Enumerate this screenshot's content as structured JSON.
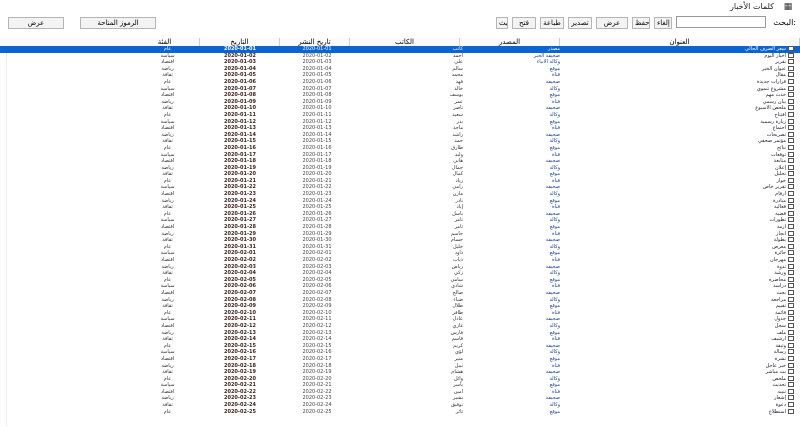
{
  "window": {
    "title": "كلمات الأخبار"
  },
  "toolbar": {
    "search_label": "البحث:",
    "buttons": [
      "إلغاء",
      "حفظ",
      "عرض",
      "تصدير",
      "طباعة",
      "فتح",
      "تحديث"
    ],
    "left_buttons": [
      "الرموز المتاحة",
      "عرض"
    ]
  },
  "columns": [
    "العنوان",
    "المصدر",
    "الكاتب",
    "تاريخ النشر",
    "التاريخ",
    "الفئة"
  ],
  "rows": [
    {
      "title": "سعر الصرف الحالي",
      "source": "مصدر",
      "author": "كاتب",
      "pub": "2020-01-01",
      "date": "2020-01-01",
      "cat": "عام"
    },
    {
      "title": "أخبار اليوم",
      "source": "صحيفة الخبر",
      "author": "احمد",
      "pub": "2020-01-02",
      "date": "2020-01-02",
      "cat": "سياسة"
    },
    {
      "title": "تقرير",
      "source": "وكالة الأنباء",
      "author": "علي",
      "pub": "2020-01-03",
      "date": "2020-01-03",
      "cat": "اقتصاد"
    },
    {
      "title": "عنوان الخبر",
      "source": "موقع",
      "author": "سالم",
      "pub": "2020-01-04",
      "date": "2020-01-04",
      "cat": "رياضة"
    },
    {
      "title": "مقال",
      "source": "قناة",
      "author": "محمد",
      "pub": "2020-01-05",
      "date": "2020-01-05",
      "cat": "ثقافة"
    },
    {
      "title": "قرارات جديدة",
      "source": "صحيفة",
      "author": "فهد",
      "pub": "2020-01-06",
      "date": "2020-01-06",
      "cat": "عام"
    },
    {
      "title": "مشروع تنموي",
      "source": "وكالة",
      "author": "خالد",
      "pub": "2020-01-07",
      "date": "2020-01-07",
      "cat": "سياسة"
    },
    {
      "title": "حدث مهم",
      "source": "موقع",
      "author": "يوسف",
      "pub": "2020-01-08",
      "date": "2020-01-08",
      "cat": "اقتصاد"
    },
    {
      "title": "بيان رسمي",
      "source": "قناة",
      "author": "عمر",
      "pub": "2020-01-09",
      "date": "2020-01-09",
      "cat": "رياضة"
    },
    {
      "title": "ملخص الأسبوع",
      "source": "صحيفة",
      "author": "ناصر",
      "pub": "2020-01-10",
      "date": "2020-01-10",
      "cat": "ثقافة"
    },
    {
      "title": "افتتاح",
      "source": "وكالة",
      "author": "سعيد",
      "pub": "2020-01-11",
      "date": "2020-01-11",
      "cat": "عام"
    },
    {
      "title": "زيارة رسمية",
      "source": "موقع",
      "author": "بدر",
      "pub": "2020-01-12",
      "date": "2020-01-12",
      "cat": "سياسة"
    },
    {
      "title": "اجتماع",
      "source": "قناة",
      "author": "ماجد",
      "pub": "2020-01-13",
      "date": "2020-01-13",
      "cat": "اقتصاد"
    },
    {
      "title": "تصريحات",
      "source": "صحيفة",
      "author": "راشد",
      "pub": "2020-01-14",
      "date": "2020-01-14",
      "cat": "رياضة"
    },
    {
      "title": "مؤتمر صحفي",
      "source": "وكالة",
      "author": "حمد",
      "pub": "2020-01-15",
      "date": "2020-01-15",
      "cat": "ثقافة"
    },
    {
      "title": "نتائج",
      "source": "موقع",
      "author": "طارق",
      "pub": "2020-01-16",
      "date": "2020-01-16",
      "cat": "عام"
    },
    {
      "title": "توقعات",
      "source": "قناة",
      "author": "وليد",
      "pub": "2020-01-17",
      "date": "2020-01-17",
      "cat": "سياسة"
    },
    {
      "title": "متابعة",
      "source": "صحيفة",
      "author": "هاني",
      "pub": "2020-01-18",
      "date": "2020-01-18",
      "cat": "اقتصاد"
    },
    {
      "title": "إعلان",
      "source": "وكالة",
      "author": "جمال",
      "pub": "2020-01-19",
      "date": "2020-01-19",
      "cat": "رياضة"
    },
    {
      "title": "تحليل",
      "source": "موقع",
      "author": "كمال",
      "pub": "2020-01-20",
      "date": "2020-01-20",
      "cat": "ثقافة"
    },
    {
      "title": "حوار",
      "source": "قناة",
      "author": "زياد",
      "pub": "2020-01-21",
      "date": "2020-01-21",
      "cat": "عام"
    },
    {
      "title": "تقرير خاص",
      "source": "صحيفة",
      "author": "رامي",
      "pub": "2020-01-22",
      "date": "2020-01-22",
      "cat": "سياسة"
    },
    {
      "title": "أرقام",
      "source": "وكالة",
      "author": "مازن",
      "pub": "2020-01-23",
      "date": "2020-01-23",
      "cat": "اقتصاد"
    },
    {
      "title": "مبادرة",
      "source": "موقع",
      "author": "نادر",
      "pub": "2020-01-24",
      "date": "2020-01-24",
      "cat": "رياضة"
    },
    {
      "title": "فعالية",
      "source": "قناة",
      "author": "إياد",
      "pub": "2020-01-25",
      "date": "2020-01-25",
      "cat": "ثقافة"
    },
    {
      "title": "قضية",
      "source": "صحيفة",
      "author": "باسل",
      "pub": "2020-01-26",
      "date": "2020-01-26",
      "cat": "عام"
    },
    {
      "title": "تطورات",
      "source": "وكالة",
      "author": "تامر",
      "pub": "2020-01-27",
      "date": "2020-01-27",
      "cat": "سياسة"
    },
    {
      "title": "أزمة",
      "source": "موقع",
      "author": "ثامر",
      "pub": "2020-01-28",
      "date": "2020-01-28",
      "cat": "اقتصاد"
    },
    {
      "title": "انجاز",
      "source": "قناة",
      "author": "جاسم",
      "pub": "2020-01-29",
      "date": "2020-01-29",
      "cat": "رياضة"
    },
    {
      "title": "بطولة",
      "source": "صحيفة",
      "author": "حسام",
      "pub": "2020-01-30",
      "date": "2020-01-30",
      "cat": "ثقافة"
    },
    {
      "title": "معرض",
      "source": "وكالة",
      "author": "خليل",
      "pub": "2020-01-31",
      "date": "2020-01-31",
      "cat": "عام"
    },
    {
      "title": "جائزة",
      "source": "موقع",
      "author": "داود",
      "pub": "2020-02-01",
      "date": "2020-02-01",
      "cat": "سياسة"
    },
    {
      "title": "مهرجان",
      "source": "قناة",
      "author": "ذياب",
      "pub": "2020-02-02",
      "date": "2020-02-02",
      "cat": "اقتصاد"
    },
    {
      "title": "ندوة",
      "source": "صحيفة",
      "author": "رياض",
      "pub": "2020-02-03",
      "date": "2020-02-03",
      "cat": "رياضة"
    },
    {
      "title": "ورشة",
      "source": "وكالة",
      "author": "زكي",
      "pub": "2020-02-04",
      "date": "2020-02-04",
      "cat": "ثقافة"
    },
    {
      "title": "محاضرة",
      "source": "موقع",
      "author": "سامي",
      "pub": "2020-02-05",
      "date": "2020-02-05",
      "cat": "عام"
    },
    {
      "title": "دراسة",
      "source": "قناة",
      "author": "شادي",
      "pub": "2020-02-06",
      "date": "2020-02-06",
      "cat": "سياسة"
    },
    {
      "title": "بحث",
      "source": "صحيفة",
      "author": "صالح",
      "pub": "2020-02-07",
      "date": "2020-02-07",
      "cat": "اقتصاد"
    },
    {
      "title": "مراجعة",
      "source": "وكالة",
      "author": "ضياء",
      "pub": "2020-02-08",
      "date": "2020-02-08",
      "cat": "رياضة"
    },
    {
      "title": "تقييم",
      "source": "موقع",
      "author": "طلال",
      "pub": "2020-02-09",
      "date": "2020-02-09",
      "cat": "ثقافة"
    },
    {
      "title": "قائمة",
      "source": "قناة",
      "author": "ظافر",
      "pub": "2020-02-10",
      "date": "2020-02-10",
      "cat": "عام"
    },
    {
      "title": "جدول",
      "source": "صحيفة",
      "author": "عادل",
      "pub": "2020-02-11",
      "date": "2020-02-11",
      "cat": "سياسة"
    },
    {
      "title": "سجل",
      "source": "وكالة",
      "author": "غازي",
      "pub": "2020-02-12",
      "date": "2020-02-12",
      "cat": "اقتصاد"
    },
    {
      "title": "ملف",
      "source": "موقع",
      "author": "فارس",
      "pub": "2020-02-13",
      "date": "2020-02-13",
      "cat": "رياضة"
    },
    {
      "title": "أرشيف",
      "source": "قناة",
      "author": "قاسم",
      "pub": "2020-02-14",
      "date": "2020-02-14",
      "cat": "ثقافة"
    },
    {
      "title": "وثيقة",
      "source": "صحيفة",
      "author": "كريم",
      "pub": "2020-02-15",
      "date": "2020-02-15",
      "cat": "عام"
    },
    {
      "title": "رسالة",
      "source": "وكالة",
      "author": "لؤي",
      "pub": "2020-02-16",
      "date": "2020-02-16",
      "cat": "سياسة"
    },
    {
      "title": "نشرة",
      "source": "موقع",
      "author": "منير",
      "pub": "2020-02-17",
      "date": "2020-02-17",
      "cat": "اقتصاد"
    },
    {
      "title": "خبر عاجل",
      "source": "قناة",
      "author": "نبيل",
      "pub": "2020-02-18",
      "date": "2020-02-18",
      "cat": "رياضة"
    },
    {
      "title": "بث مباشر",
      "source": "صحيفة",
      "author": "هشام",
      "pub": "2020-02-19",
      "date": "2020-02-19",
      "cat": "ثقافة"
    },
    {
      "title": "ملخص",
      "source": "وكالة",
      "author": "وائل",
      "pub": "2020-02-20",
      "date": "2020-02-20",
      "cat": "عام"
    },
    {
      "title": "تحديث",
      "source": "موقع",
      "author": "ياسر",
      "pub": "2020-02-21",
      "date": "2020-02-21",
      "cat": "سياسة"
    },
    {
      "title": "تنبيه",
      "source": "قناة",
      "author": "أمين",
      "pub": "2020-02-22",
      "date": "2020-02-22",
      "cat": "اقتصاد"
    },
    {
      "title": "إشعار",
      "source": "صحيفة",
      "author": "بشير",
      "pub": "2020-02-23",
      "date": "2020-02-23",
      "cat": "رياضة"
    },
    {
      "title": "دعوة",
      "source": "وكالة",
      "author": "توفيق",
      "pub": "2020-02-24",
      "date": "2020-02-24",
      "cat": "ثقافة"
    },
    {
      "title": "استطلاع",
      "source": "موقع",
      "author": "ثائر",
      "pub": "2020-02-25",
      "date": "2020-02-25",
      "cat": "عام"
    }
  ]
}
